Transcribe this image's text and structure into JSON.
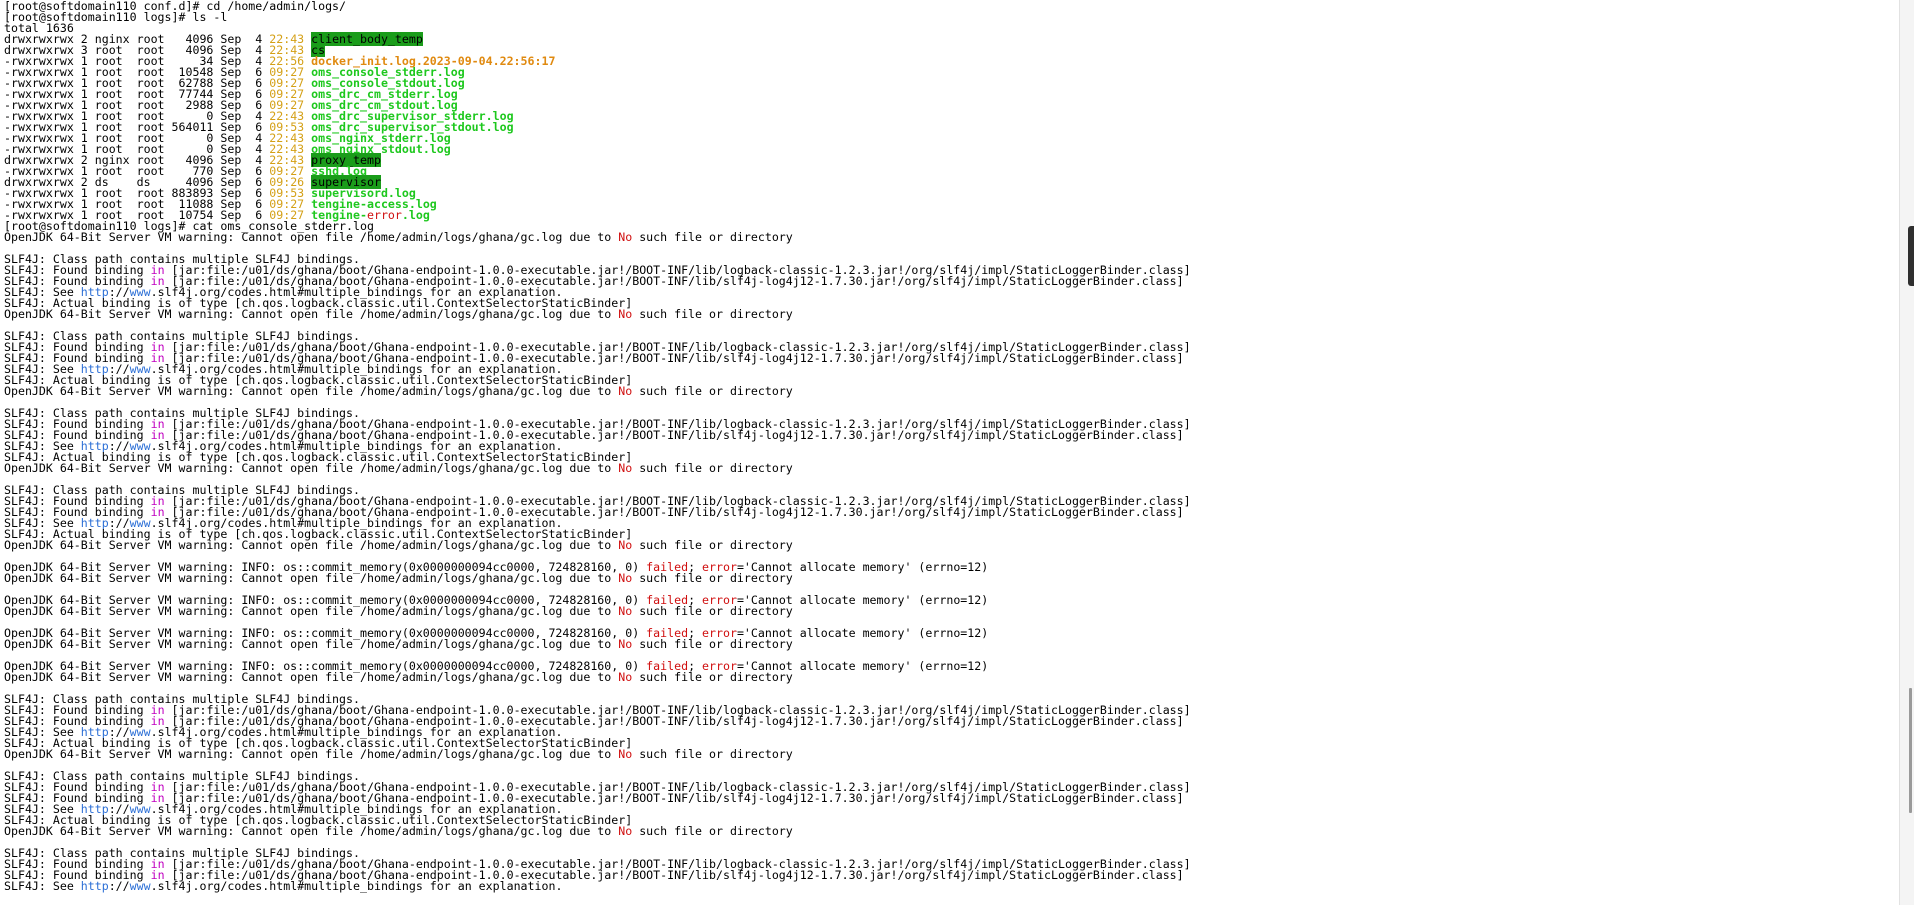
{
  "colors": {
    "background": "#ffffff",
    "text": "#000000",
    "timestamp": "#d4a016",
    "filename": "#1ec81e",
    "dir_highlight": "#1a9c1a",
    "keyword_in": "#c000c0",
    "url": "#2c6fd6",
    "error": "#d01010",
    "orange_file": "#e08a10"
  },
  "terminal": {
    "lines": [
      [
        {
          "t": "[root@softdomain110 conf.d]# cd /home/admin/logs/"
        }
      ],
      [
        {
          "t": "[root@softdomain110 logs]# ls -l"
        }
      ],
      [
        {
          "t": "total 1636"
        }
      ],
      [
        {
          "t": "drwxrwxrwx 2 nginx root   4096 Sep  4 "
        },
        {
          "t": "22:43",
          "c": "time"
        },
        {
          "t": " "
        },
        {
          "t": "client_body_temp",
          "c": "dirhl"
        }
      ],
      [
        {
          "t": "drwxrwxrwx 3 root  root   4096 Sep  4 "
        },
        {
          "t": "22:43",
          "c": "time"
        },
        {
          "t": " "
        },
        {
          "t": "cs",
          "c": "dirhl"
        }
      ],
      [
        {
          "t": "-rwxrwxrwx 1 root  root     34 Sep  4 "
        },
        {
          "t": "22:56",
          "c": "time"
        },
        {
          "t": " "
        },
        {
          "t": "docker_init.log.2023-09-04.22:56:17",
          "c": "orange"
        }
      ],
      [
        {
          "t": "-rwxrwxrwx 1 root  root  10548 Sep  6 "
        },
        {
          "t": "09:27",
          "c": "time"
        },
        {
          "t": " "
        },
        {
          "t": "oms_console_stderr.log",
          "c": "name"
        }
      ],
      [
        {
          "t": "-rwxrwxrwx 1 root  root  62788 Sep  6 "
        },
        {
          "t": "09:27",
          "c": "time"
        },
        {
          "t": " "
        },
        {
          "t": "oms_console_stdout.log",
          "c": "name"
        }
      ],
      [
        {
          "t": "-rwxrwxrwx 1 root  root  77744 Sep  6 "
        },
        {
          "t": "09:27",
          "c": "time"
        },
        {
          "t": " "
        },
        {
          "t": "oms_drc_cm_stderr.log",
          "c": "name"
        }
      ],
      [
        {
          "t": "-rwxrwxrwx 1 root  root   2988 Sep  6 "
        },
        {
          "t": "09:27",
          "c": "time"
        },
        {
          "t": " "
        },
        {
          "t": "oms_drc_cm_stdout.log",
          "c": "name"
        }
      ],
      [
        {
          "t": "-rwxrwxrwx 1 root  root      0 Sep  4 "
        },
        {
          "t": "22:43",
          "c": "time"
        },
        {
          "t": " "
        },
        {
          "t": "oms_drc_supervisor_stderr.log",
          "c": "name"
        }
      ],
      [
        {
          "t": "-rwxrwxrwx 1 root  root 564011 Sep  6 "
        },
        {
          "t": "09:53",
          "c": "time"
        },
        {
          "t": " "
        },
        {
          "t": "oms_drc_supervisor_stdout.log",
          "c": "name"
        }
      ],
      [
        {
          "t": "-rwxrwxrwx 1 root  root      0 Sep  4 "
        },
        {
          "t": "22:43",
          "c": "time"
        },
        {
          "t": " "
        },
        {
          "t": "oms_nginx_stderr.log",
          "c": "name"
        }
      ],
      [
        {
          "t": "-rwxrwxrwx 1 root  root      0 Sep  4 "
        },
        {
          "t": "22:43",
          "c": "time"
        },
        {
          "t": " "
        },
        {
          "t": "oms_nginx_stdout.log",
          "c": "name"
        }
      ],
      [
        {
          "t": "drwxrwxrwx 2 nginx root   4096 Sep  4 "
        },
        {
          "t": "22:43",
          "c": "time"
        },
        {
          "t": " "
        },
        {
          "t": "proxy_temp",
          "c": "dirhl"
        }
      ],
      [
        {
          "t": "-rwxrwxrwx 1 root  root    770 Sep  6 "
        },
        {
          "t": "09:27",
          "c": "time"
        },
        {
          "t": " "
        },
        {
          "t": "sshd.log",
          "c": "name"
        }
      ],
      [
        {
          "t": "drwxrwxrwx 2 ds    ds     4096 Sep  6 "
        },
        {
          "t": "09:26",
          "c": "time"
        },
        {
          "t": " "
        },
        {
          "t": "supervisor",
          "c": "dirhl"
        }
      ],
      [
        {
          "t": "-rwxrwxrwx 1 root  root 883893 Sep  6 "
        },
        {
          "t": "09:53",
          "c": "time"
        },
        {
          "t": " "
        },
        {
          "t": "supervisord.log",
          "c": "name"
        }
      ],
      [
        {
          "t": "-rwxrwxrwx 1 root  root  11088 Sep  6 "
        },
        {
          "t": "09:27",
          "c": "time"
        },
        {
          "t": " "
        },
        {
          "t": "tengine-access.log",
          "c": "name"
        }
      ],
      [
        {
          "t": "-rwxrwxrwx 1 root  root  10754 Sep  6 "
        },
        {
          "t": "09:27",
          "c": "time"
        },
        {
          "t": " "
        },
        {
          "t": "tengine-",
          "c": "name"
        },
        {
          "t": "error",
          "c": "red"
        },
        {
          "t": ".log",
          "c": "name"
        }
      ],
      [
        {
          "t": "[root@softdomain110 logs]# cat oms_console_stderr.log"
        }
      ],
      [
        {
          "t": "OpenJDK 64-Bit Server VM warning: Cannot open file /home/admin/logs/ghana/gc.log due to "
        },
        {
          "t": "No",
          "c": "red"
        },
        {
          "t": " such file or directory"
        }
      ],
      [
        {
          "t": ""
        }
      ],
      [
        {
          "t": "SLF4J: Class path contains multiple SLF4J bindings."
        }
      ],
      [
        {
          "t": "SLF4J: Found binding "
        },
        {
          "t": "in",
          "c": "in"
        },
        {
          "t": " [jar:file:/u01/ds/ghana/boot/Ghana-endpoint-1.0.0-executable.jar!/BOOT-INF/lib/logback-classic-1.2.3.jar!/org/slf4j/impl/StaticLoggerBinder.class]"
        }
      ],
      [
        {
          "t": "SLF4J: Found binding "
        },
        {
          "t": "in",
          "c": "in"
        },
        {
          "t": " [jar:file:/u01/ds/ghana/boot/Ghana-endpoint-1.0.0-executable.jar!/BOOT-INF/lib/slf4j-log4j12-1.7.30.jar!/org/slf4j/impl/StaticLoggerBinder.class]"
        }
      ],
      [
        {
          "t": "SLF4J: See "
        },
        {
          "t": "http",
          "c": "url"
        },
        {
          "t": "://"
        },
        {
          "t": "www",
          "c": "url"
        },
        {
          "t": ".slf4j.org/codes.html#multiple_bindings for an explanation."
        }
      ],
      [
        {
          "t": "SLF4J: Actual binding is of type [ch.qos.logback.classic.util.ContextSelectorStaticBinder]"
        }
      ],
      [
        {
          "t": "OpenJDK 64-Bit Server VM warning: Cannot open file /home/admin/logs/ghana/gc.log due to "
        },
        {
          "t": "No",
          "c": "red"
        },
        {
          "t": " such file or directory"
        }
      ],
      [
        {
          "t": ""
        }
      ],
      [
        {
          "t": "SLF4J: Class path contains multiple SLF4J bindings."
        }
      ],
      [
        {
          "t": "SLF4J: Found binding "
        },
        {
          "t": "in",
          "c": "in"
        },
        {
          "t": " [jar:file:/u01/ds/ghana/boot/Ghana-endpoint-1.0.0-executable.jar!/BOOT-INF/lib/logback-classic-1.2.3.jar!/org/slf4j/impl/StaticLoggerBinder.class]"
        }
      ],
      [
        {
          "t": "SLF4J: Found binding "
        },
        {
          "t": "in",
          "c": "in"
        },
        {
          "t": " [jar:file:/u01/ds/ghana/boot/Ghana-endpoint-1.0.0-executable.jar!/BOOT-INF/lib/slf4j-log4j12-1.7.30.jar!/org/slf4j/impl/StaticLoggerBinder.class]"
        }
      ],
      [
        {
          "t": "SLF4J: See "
        },
        {
          "t": "http",
          "c": "url"
        },
        {
          "t": "://"
        },
        {
          "t": "www",
          "c": "url"
        },
        {
          "t": ".slf4j.org/codes.html#multiple_bindings for an explanation."
        }
      ],
      [
        {
          "t": "SLF4J: Actual binding is of type [ch.qos.logback.classic.util.ContextSelectorStaticBinder]"
        }
      ],
      [
        {
          "t": "OpenJDK 64-Bit Server VM warning: Cannot open file /home/admin/logs/ghana/gc.log due to "
        },
        {
          "t": "No",
          "c": "red"
        },
        {
          "t": " such file or directory"
        }
      ],
      [
        {
          "t": ""
        }
      ],
      [
        {
          "t": "SLF4J: Class path contains multiple SLF4J bindings."
        }
      ],
      [
        {
          "t": "SLF4J: Found binding "
        },
        {
          "t": "in",
          "c": "in"
        },
        {
          "t": " [jar:file:/u01/ds/ghana/boot/Ghana-endpoint-1.0.0-executable.jar!/BOOT-INF/lib/logback-classic-1.2.3.jar!/org/slf4j/impl/StaticLoggerBinder.class]"
        }
      ],
      [
        {
          "t": "SLF4J: Found binding "
        },
        {
          "t": "in",
          "c": "in"
        },
        {
          "t": " [jar:file:/u01/ds/ghana/boot/Ghana-endpoint-1.0.0-executable.jar!/BOOT-INF/lib/slf4j-log4j12-1.7.30.jar!/org/slf4j/impl/StaticLoggerBinder.class]"
        }
      ],
      [
        {
          "t": "SLF4J: See "
        },
        {
          "t": "http",
          "c": "url"
        },
        {
          "t": "://"
        },
        {
          "t": "www",
          "c": "url"
        },
        {
          "t": ".slf4j.org/codes.html#multiple_bindings for an explanation."
        }
      ],
      [
        {
          "t": "SLF4J: Actual binding is of type [ch.qos.logback.classic.util.ContextSelectorStaticBinder]"
        }
      ],
      [
        {
          "t": "OpenJDK 64-Bit Server VM warning: Cannot open file /home/admin/logs/ghana/gc.log due to "
        },
        {
          "t": "No",
          "c": "red"
        },
        {
          "t": " such file or directory"
        }
      ],
      [
        {
          "t": ""
        }
      ],
      [
        {
          "t": "SLF4J: Class path contains multiple SLF4J bindings."
        }
      ],
      [
        {
          "t": "SLF4J: Found binding "
        },
        {
          "t": "in",
          "c": "in"
        },
        {
          "t": " [jar:file:/u01/ds/ghana/boot/Ghana-endpoint-1.0.0-executable.jar!/BOOT-INF/lib/logback-classic-1.2.3.jar!/org/slf4j/impl/StaticLoggerBinder.class]"
        }
      ],
      [
        {
          "t": "SLF4J: Found binding "
        },
        {
          "t": "in",
          "c": "in"
        },
        {
          "t": " [jar:file:/u01/ds/ghana/boot/Ghana-endpoint-1.0.0-executable.jar!/BOOT-INF/lib/slf4j-log4j12-1.7.30.jar!/org/slf4j/impl/StaticLoggerBinder.class]"
        }
      ],
      [
        {
          "t": "SLF4J: See "
        },
        {
          "t": "http",
          "c": "url"
        },
        {
          "t": "://"
        },
        {
          "t": "www",
          "c": "url"
        },
        {
          "t": ".slf4j.org/codes.html#multiple_bindings for an explanation."
        }
      ],
      [
        {
          "t": "SLF4J: Actual binding is of type [ch.qos.logback.classic.util.ContextSelectorStaticBinder]"
        }
      ],
      [
        {
          "t": "OpenJDK 64-Bit Server VM warning: Cannot open file /home/admin/logs/ghana/gc.log due to "
        },
        {
          "t": "No",
          "c": "red"
        },
        {
          "t": " such file or directory"
        }
      ],
      [
        {
          "t": ""
        }
      ],
      [
        {
          "t": "OpenJDK 64-Bit Server VM warning: INFO: os::commit_memory(0x0000000094cc0000, 724828160, 0) "
        },
        {
          "t": "failed",
          "c": "red"
        },
        {
          "t": "; "
        },
        {
          "t": "error",
          "c": "red"
        },
        {
          "t": "='Cannot allocate memory' (errno=12)"
        }
      ],
      [
        {
          "t": "OpenJDK 64-Bit Server VM warning: Cannot open file /home/admin/logs/ghana/gc.log due to "
        },
        {
          "t": "No",
          "c": "red"
        },
        {
          "t": " such file or directory"
        }
      ],
      [
        {
          "t": ""
        }
      ],
      [
        {
          "t": "OpenJDK 64-Bit Server VM warning: INFO: os::commit_memory(0x0000000094cc0000, 724828160, 0) "
        },
        {
          "t": "failed",
          "c": "red"
        },
        {
          "t": "; "
        },
        {
          "t": "error",
          "c": "red"
        },
        {
          "t": "='Cannot allocate memory' (errno=12)"
        }
      ],
      [
        {
          "t": "OpenJDK 64-Bit Server VM warning: Cannot open file /home/admin/logs/ghana/gc.log due to "
        },
        {
          "t": "No",
          "c": "red"
        },
        {
          "t": " such file or directory"
        }
      ],
      [
        {
          "t": ""
        }
      ],
      [
        {
          "t": "OpenJDK 64-Bit Server VM warning: INFO: os::commit_memory(0x0000000094cc0000, 724828160, 0) "
        },
        {
          "t": "failed",
          "c": "red"
        },
        {
          "t": "; "
        },
        {
          "t": "error",
          "c": "red"
        },
        {
          "t": "='Cannot allocate memory' (errno=12)"
        }
      ],
      [
        {
          "t": "OpenJDK 64-Bit Server VM warning: Cannot open file /home/admin/logs/ghana/gc.log due to "
        },
        {
          "t": "No",
          "c": "red"
        },
        {
          "t": " such file or directory"
        }
      ],
      [
        {
          "t": ""
        }
      ],
      [
        {
          "t": "OpenJDK 64-Bit Server VM warning: INFO: os::commit_memory(0x0000000094cc0000, 724828160, 0) "
        },
        {
          "t": "failed",
          "c": "red"
        },
        {
          "t": "; "
        },
        {
          "t": "error",
          "c": "red"
        },
        {
          "t": "='Cannot allocate memory' (errno=12)"
        }
      ],
      [
        {
          "t": "OpenJDK 64-Bit Server VM warning: Cannot open file /home/admin/logs/ghana/gc.log due to "
        },
        {
          "t": "No",
          "c": "red"
        },
        {
          "t": " such file or directory"
        }
      ],
      [
        {
          "t": ""
        }
      ],
      [
        {
          "t": "SLF4J: Class path contains multiple SLF4J bindings."
        }
      ],
      [
        {
          "t": "SLF4J: Found binding "
        },
        {
          "t": "in",
          "c": "in"
        },
        {
          "t": " [jar:file:/u01/ds/ghana/boot/Ghana-endpoint-1.0.0-executable.jar!/BOOT-INF/lib/logback-classic-1.2.3.jar!/org/slf4j/impl/StaticLoggerBinder.class]"
        }
      ],
      [
        {
          "t": "SLF4J: Found binding "
        },
        {
          "t": "in",
          "c": "in"
        },
        {
          "t": " [jar:file:/u01/ds/ghana/boot/Ghana-endpoint-1.0.0-executable.jar!/BOOT-INF/lib/slf4j-log4j12-1.7.30.jar!/org/slf4j/impl/StaticLoggerBinder.class]"
        }
      ],
      [
        {
          "t": "SLF4J: See "
        },
        {
          "t": "http",
          "c": "url"
        },
        {
          "t": "://"
        },
        {
          "t": "www",
          "c": "url"
        },
        {
          "t": ".slf4j.org/codes.html#multiple_bindings for an explanation."
        }
      ],
      [
        {
          "t": "SLF4J: Actual binding is of type [ch.qos.logback.classic.util.ContextSelectorStaticBinder]"
        }
      ],
      [
        {
          "t": "OpenJDK 64-Bit Server VM warning: Cannot open file /home/admin/logs/ghana/gc.log due to "
        },
        {
          "t": "No",
          "c": "red"
        },
        {
          "t": " such file or directory"
        }
      ],
      [
        {
          "t": ""
        }
      ],
      [
        {
          "t": "SLF4J: Class path contains multiple SLF4J bindings."
        }
      ],
      [
        {
          "t": "SLF4J: Found binding "
        },
        {
          "t": "in",
          "c": "in"
        },
        {
          "t": " [jar:file:/u01/ds/ghana/boot/Ghana-endpoint-1.0.0-executable.jar!/BOOT-INF/lib/logback-classic-1.2.3.jar!/org/slf4j/impl/StaticLoggerBinder.class]"
        }
      ],
      [
        {
          "t": "SLF4J: Found binding "
        },
        {
          "t": "in",
          "c": "in"
        },
        {
          "t": " [jar:file:/u01/ds/ghana/boot/Ghana-endpoint-1.0.0-executable.jar!/BOOT-INF/lib/slf4j-log4j12-1.7.30.jar!/org/slf4j/impl/StaticLoggerBinder.class]"
        }
      ],
      [
        {
          "t": "SLF4J: See "
        },
        {
          "t": "http",
          "c": "url"
        },
        {
          "t": "://"
        },
        {
          "t": "www",
          "c": "url"
        },
        {
          "t": ".slf4j.org/codes.html#multiple_bindings for an explanation."
        }
      ],
      [
        {
          "t": "SLF4J: Actual binding is of type [ch.qos.logback.classic.util.ContextSelectorStaticBinder]"
        }
      ],
      [
        {
          "t": "OpenJDK 64-Bit Server VM warning: Cannot open file /home/admin/logs/ghana/gc.log due to "
        },
        {
          "t": "No",
          "c": "red"
        },
        {
          "t": " such file or directory"
        }
      ],
      [
        {
          "t": ""
        }
      ],
      [
        {
          "t": "SLF4J: Class path contains multiple SLF4J bindings."
        }
      ],
      [
        {
          "t": "SLF4J: Found binding "
        },
        {
          "t": "in",
          "c": "in"
        },
        {
          "t": " [jar:file:/u01/ds/ghana/boot/Ghana-endpoint-1.0.0-executable.jar!/BOOT-INF/lib/logback-classic-1.2.3.jar!/org/slf4j/impl/StaticLoggerBinder.class]"
        }
      ],
      [
        {
          "t": "SLF4J: Found binding "
        },
        {
          "t": "in",
          "c": "in"
        },
        {
          "t": " [jar:file:/u01/ds/ghana/boot/Ghana-endpoint-1.0.0-executable.jar!/BOOT-INF/lib/slf4j-log4j12-1.7.30.jar!/org/slf4j/impl/StaticLoggerBinder.class]"
        }
      ],
      [
        {
          "t": "SLF4J: See "
        },
        {
          "t": "http",
          "c": "url"
        },
        {
          "t": "://"
        },
        {
          "t": "www",
          "c": "url"
        },
        {
          "t": ".slf4j.org/codes.html#multiple_bindings for an explanation."
        }
      ]
    ]
  }
}
